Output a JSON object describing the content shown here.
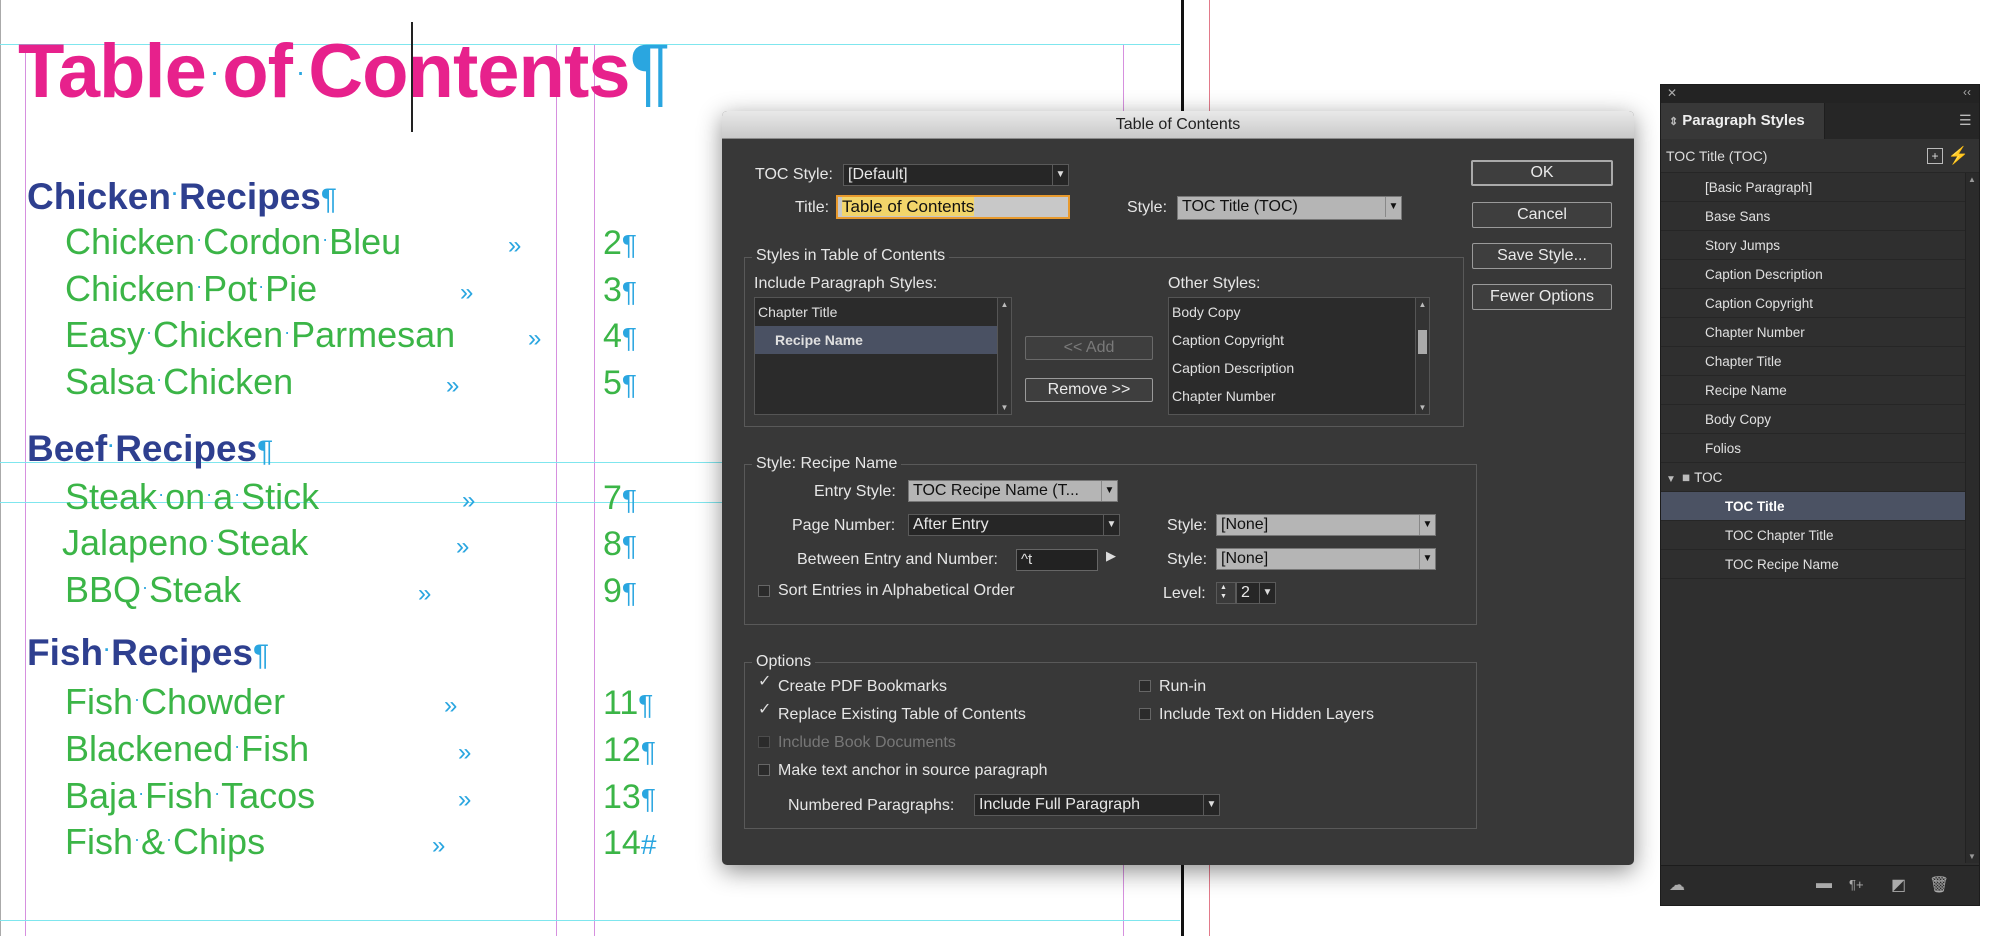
{
  "document": {
    "title_words": [
      "Table",
      "of",
      "Contents"
    ],
    "pilcrow": "¶",
    "dot": "·",
    "tab_marker": "»",
    "end_marker": "#",
    "sections": [
      {
        "heading": [
          "Chicken",
          "Recipes"
        ],
        "entries": [
          {
            "words": [
              "Chicken",
              "Cordon",
              "Bleu"
            ],
            "page": "2"
          },
          {
            "words": [
              "Chicken",
              "Pot",
              "Pie"
            ],
            "page": "3"
          },
          {
            "words": [
              "Easy",
              "Chicken",
              "Parmesan"
            ],
            "page": "4"
          },
          {
            "words": [
              "Salsa",
              "Chicken"
            ],
            "page": "5"
          }
        ]
      },
      {
        "heading": [
          "Beef",
          "Recipes"
        ],
        "entries": [
          {
            "words": [
              "Steak",
              "on",
              "a",
              "Stick"
            ],
            "page": "7"
          },
          {
            "words": [
              "Jalapeno",
              "Steak"
            ],
            "page": "8"
          },
          {
            "words": [
              "BBQ",
              "Steak"
            ],
            "page": "9"
          }
        ]
      },
      {
        "heading": [
          "Fish",
          "Recipes"
        ],
        "entries": [
          {
            "words": [
              "Fish",
              "Chowder"
            ],
            "page": "11"
          },
          {
            "words": [
              "Blackened",
              "Fish"
            ],
            "page": "12"
          },
          {
            "words": [
              "Baja",
              "Fish",
              "Tacos"
            ],
            "page": "13"
          },
          {
            "words": [
              "Fish",
              "&",
              "Chips"
            ],
            "page": "14"
          }
        ]
      }
    ]
  },
  "dialog": {
    "title": "Table of Contents",
    "toc_style_label": "TOC Style:",
    "toc_style_value": "[Default]",
    "title_label": "Title:",
    "title_value": "Table of Contents",
    "style_label": "Style:",
    "title_style_value": "TOC Title (TOC)",
    "buttons": {
      "ok": "OK",
      "cancel": "Cancel",
      "save_style": "Save Style...",
      "fewer_options": "Fewer Options",
      "add": "<< Add",
      "remove": "Remove >>"
    },
    "styles_group": {
      "title": "Styles in Table of Contents",
      "include_label": "Include Paragraph Styles:",
      "include_items": [
        "Chapter Title",
        "Recipe Name"
      ],
      "selected_include": "Recipe Name",
      "other_label": "Other Styles:",
      "other_items": [
        "Body Copy",
        "Caption Copyright",
        "Caption Description",
        "Chapter Number"
      ]
    },
    "style_group": {
      "title": "Style: Recipe Name",
      "entry_style_label": "Entry Style:",
      "entry_style_value": "TOC Recipe Name (T...",
      "page_number_label": "Page Number:",
      "page_number_value": "After Entry",
      "style_label": "Style:",
      "page_number_style": "[None]",
      "between_label": "Between Entry and Number:",
      "between_value": "^t",
      "between_style": "[None]",
      "sort_label": "Sort Entries in Alphabetical Order",
      "sort_checked": false,
      "level_label": "Level:",
      "level_value": "2"
    },
    "options_group": {
      "title": "Options",
      "create_pdf_bookmarks": {
        "label": "Create PDF Bookmarks",
        "checked": true
      },
      "replace_existing": {
        "label": "Replace Existing Table of Contents",
        "checked": true
      },
      "include_book_documents": {
        "label": "Include Book Documents",
        "checked": false,
        "disabled": true
      },
      "make_text_anchor": {
        "label": "Make text anchor in source paragraph",
        "checked": false
      },
      "run_in": {
        "label": "Run-in",
        "checked": false
      },
      "include_hidden_layers": {
        "label": "Include Text on Hidden Layers",
        "checked": false
      },
      "numbered_paragraphs_label": "Numbered Paragraphs:",
      "numbered_paragraphs_value": "Include Full Paragraph"
    }
  },
  "panel": {
    "tab_title": "Paragraph Styles",
    "current_style": "TOC Title (TOC)",
    "items": [
      "[Basic Paragraph]",
      "Base Sans",
      "Story Jumps",
      "Caption Description",
      "Caption Copyright",
      "Chapter Number",
      "Chapter Title",
      "Recipe Name",
      "Body Copy",
      "Folios"
    ],
    "group_name": "TOC",
    "group_items": [
      "TOC Title",
      "TOC Chapter Title",
      "TOC Recipe Name"
    ],
    "selected_item": "TOC Title"
  },
  "colors": {
    "title_magenta": "#e7218c",
    "heading_navy": "#2e3f8f",
    "entry_green": "#3bb547",
    "hidden_char_blue": "#2aa6e0",
    "dialog_bg": "#383838",
    "panel_selection": "#4b5263"
  }
}
